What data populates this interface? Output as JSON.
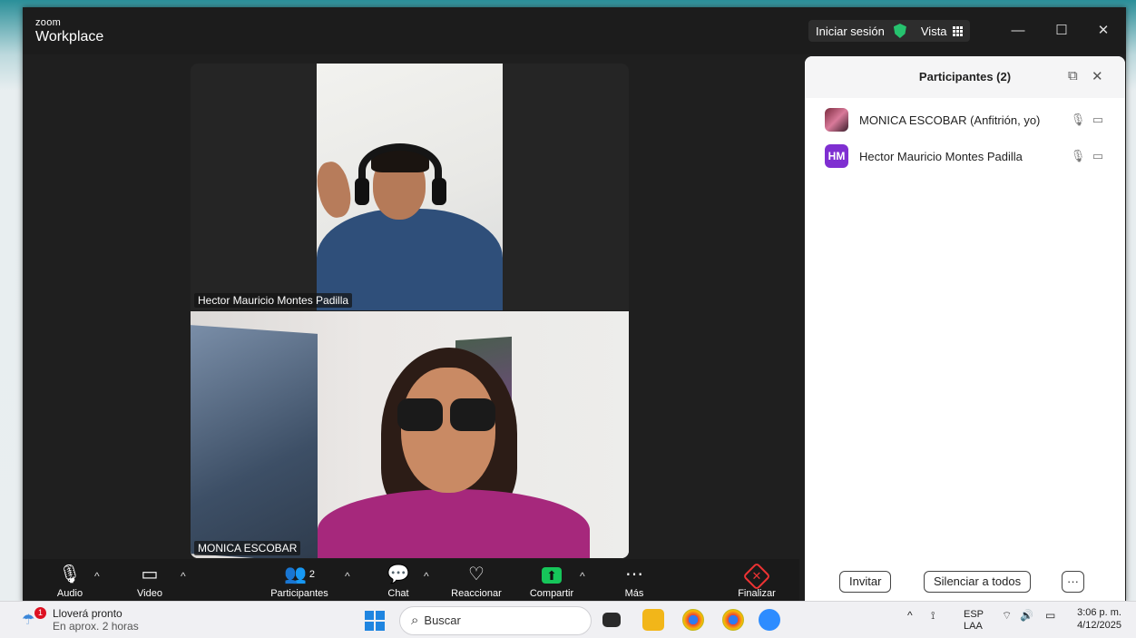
{
  "titlebar": {
    "brand_small": "zoom",
    "brand_large": "Workplace",
    "login_label": "Iniciar sesión",
    "view_label": "Vista",
    "minimize": "—",
    "maximize": "☐",
    "close": "✕"
  },
  "video": {
    "top_name": "Hector Mauricio Montes Padilla",
    "bottom_name": "MONICA ESCOBAR"
  },
  "toolbar": {
    "audio": "Audio",
    "video": "Video",
    "participants": "Participantes",
    "participants_count": "2",
    "chat": "Chat",
    "react": "Reaccionar",
    "share": "Compartir",
    "more": "Más",
    "end": "Finalizar"
  },
  "panel": {
    "title": "Participantes (2)",
    "participants": [
      {
        "name": "MONICA ESCOBAR (Anfitrión, yo)",
        "avatar": "photo"
      },
      {
        "name": "Hector Mauricio Montes Padilla",
        "avatar": "HM"
      }
    ],
    "invite": "Invitar",
    "mute_all": "Silenciar a todos",
    "more": "···"
  },
  "taskbar": {
    "weather_title": "Lloverá pronto",
    "weather_sub": "En aprox. 2 horas",
    "weather_badge": "1",
    "search_placeholder": "Buscar",
    "lang_top": "ESP",
    "lang_bottom": "LAA",
    "time": "3:06 p. m.",
    "date": "4/12/2025"
  },
  "colors": {
    "accent_green": "#16c65a",
    "end_red": "#e33333",
    "avatar_purple": "#7f2fd1",
    "panel_bg": "#ffffff",
    "toolbar_bg": "#1a1a1a"
  }
}
